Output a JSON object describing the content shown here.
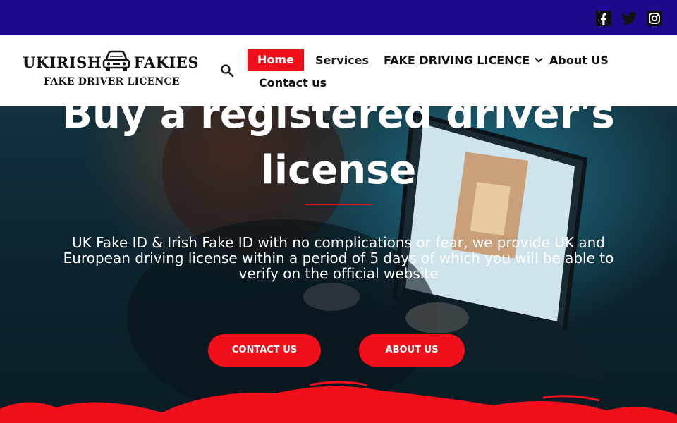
{
  "social": {
    "icons": [
      "facebook-icon",
      "twitter-icon",
      "instagram-icon"
    ]
  },
  "logo": {
    "left_text": "UKIRISH",
    "right_text": "FAKIES",
    "subtitle": "FAKE DRIVER LICENCE"
  },
  "nav": {
    "home": "Home",
    "services": "Services",
    "fake_driving_licence": "FAKE DRIVING LICENCE",
    "about": "About US",
    "contact": "Contact us"
  },
  "hero": {
    "title_line1": "Buy a registered driver's",
    "title_line2": "license",
    "text": "UK Fake ID & Irish Fake ID with no complications or fear, we provide UK and European driving license within a period of 5 days of which you will be able to verify on the official website",
    "contact_button": "CONTACT US",
    "about_button": "ABOUT US"
  },
  "colors": {
    "topbar": "#1c0a8c",
    "accent": "#f0101b",
    "header_bg": "#ffffff"
  }
}
